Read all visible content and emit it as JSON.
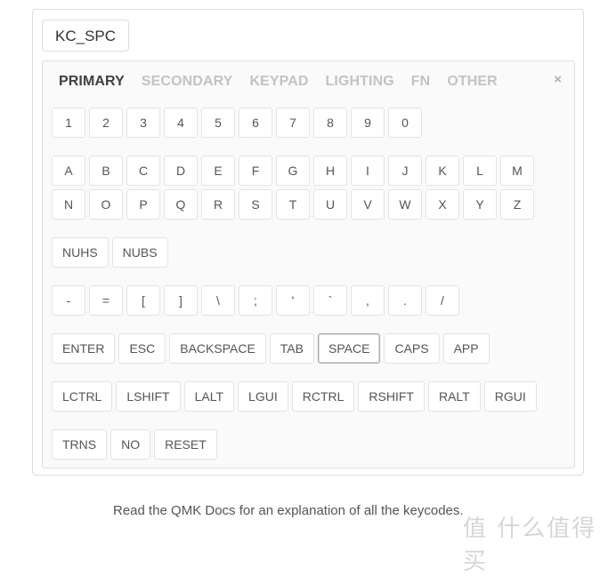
{
  "keycode_input": {
    "value": "KC_SPC"
  },
  "tabs": [
    {
      "label": "PRIMARY",
      "active": true
    },
    {
      "label": "SECONDARY",
      "active": false
    },
    {
      "label": "KEYPAD",
      "active": false
    },
    {
      "label": "LIGHTING",
      "active": false
    },
    {
      "label": "FN",
      "active": false
    },
    {
      "label": "OTHER",
      "active": false
    }
  ],
  "close_label": "×",
  "rows": {
    "numbers": [
      "1",
      "2",
      "3",
      "4",
      "5",
      "6",
      "7",
      "8",
      "9",
      "0"
    ],
    "letters1": [
      "A",
      "B",
      "C",
      "D",
      "E",
      "F",
      "G",
      "H",
      "I",
      "J",
      "K",
      "L",
      "M"
    ],
    "letters2": [
      "N",
      "O",
      "P",
      "Q",
      "R",
      "S",
      "T",
      "U",
      "V",
      "W",
      "X",
      "Y",
      "Z"
    ],
    "nonus": [
      "NUHS",
      "NUBS"
    ],
    "symbols": [
      "-",
      "=",
      "[",
      "]",
      "\\",
      ";",
      "'",
      "`",
      ",",
      ".",
      "/"
    ],
    "special": [
      "ENTER",
      "ESC",
      "BACKSPACE",
      "TAB",
      "SPACE",
      "CAPS",
      "APP"
    ],
    "modifiers": [
      "LCTRL",
      "LSHIFT",
      "LALT",
      "LGUI",
      "RCTRL",
      "RSHIFT",
      "RALT",
      "RGUI"
    ],
    "misc": [
      "TRNS",
      "NO",
      "RESET"
    ]
  },
  "selected_key": "SPACE",
  "footer": {
    "text": "Read the QMK Docs for an explanation of all the keycodes."
  },
  "watermark": {
    "text": "值 什么值得买"
  }
}
